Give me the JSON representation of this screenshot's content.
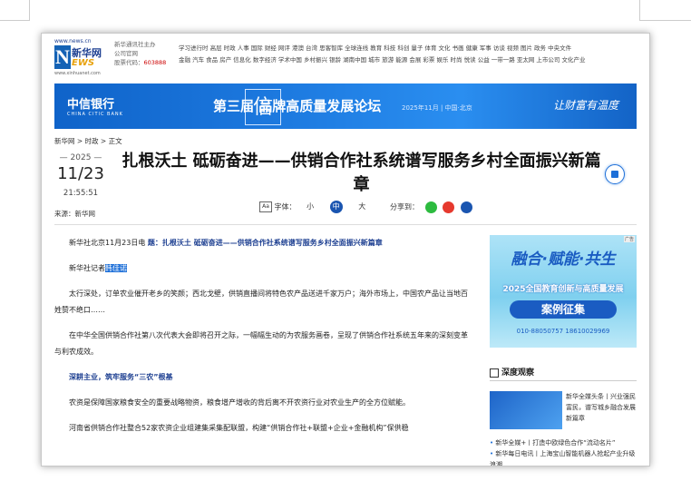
{
  "header": {
    "logo_url": "www.news.cn",
    "logo_cn": "新华网",
    "logo_xinhuanet": "www.xinhuanet.com",
    "mobile_label": "新华通讯社主办",
    "mobile_site": "公司官网",
    "mobile_code_label": "股票代码：",
    "mobile_code": "603888",
    "nav_line1": "学习进行时 高层 时政 人事 国际 财经 网评 港澳 台湾 思客智库 全球连线 教育 科技 科创 量子 体育 文化 书画 健康 军事 访谈 视频 图片 政务 中央文件",
    "nav_line2": "金融 汽车 食品 房产 信息化 数字经济 学术中国 乡村振兴 银龄 湖南中国 城市 旅游 能源 会展 彩票 娱乐 时尚 悦读 公益 一带一路 亚太网 上市公司 文化产业"
  },
  "banner": {
    "bank": "中信银行",
    "bank_en": "CHINA CITIC BANK",
    "badge": "信",
    "headline": "第三届 品牌高质量发展论坛",
    "meta": "2025年11月 | 中国·北京",
    "slogan": "让财富有温度"
  },
  "breadcrumb": "新华网 > 时政 > 正文",
  "date": {
    "year": "2025",
    "monthday": "11/23",
    "time": "21:55:51"
  },
  "source": "来源：新华网",
  "title": "扎根沃土 砥砺奋进——供销合作社系统谱写服务乡村全面振兴新篇章",
  "tools": {
    "font_icon": "Aa",
    "font_label": "字体：",
    "small": "小",
    "medium": "中",
    "large": "大",
    "share_label": "分享到："
  },
  "article": {
    "lead_prefix": "新华社北京11月23日电 ",
    "lead_title": "题：扎根沃土 砥砺奋进——供销合作社系统谱写服务乡村全面振兴新篇章",
    "reporter_prefix": "新华社记者",
    "reporter_name": "韩佳诺",
    "p1": "太行深处，订单农业催开老乡的笑颜；西北戈壁，供销直播间将特色农产品送进千家万户；海外市场上，中国农产品让当地百姓赞不绝口……",
    "p2": "在中华全国供销合作社第八次代表大会即将召开之际，一幅幅生动的为农服务画卷，呈现了供销合作社系统五年来的深刻变革与利农成效。",
    "subhead": "深耕主业，筑牢服务“三农”根基",
    "p3": "农资是保障国家粮食安全的重要战略物资，粮食增产增收的背后离不开农资行业对农业生产的全方位赋能。",
    "p4": "河南省供销合作社整合52家农资企业组建集采集配联盟，构建“供销合作社+联盟+企业+金融机构”保供稳"
  },
  "ad": {
    "mark": "广告",
    "t1": "融合·赋能·共生",
    "t2": "2025全国教育创新与高质量发展",
    "t3": "案例征集",
    "t4": "010-88050757  18610029969"
  },
  "sidebar": {
    "section_title": "深度观察",
    "deep_text": "新华全媒头条丨兴业强民富民，谱写城乡融合发展新篇章",
    "news": [
      "新华全媒+丨打造中欧绿色合作“流动名片”",
      "新华每日电讯丨上海宝山智能机器人抢起产业升级浪潮"
    ]
  },
  "colors": {
    "accent": "#1d3f91",
    "link_blue": "#1d6fd8",
    "wechat": "#2dbb3f",
    "weibo": "#e6392e",
    "qzone": "#1a55b0"
  }
}
